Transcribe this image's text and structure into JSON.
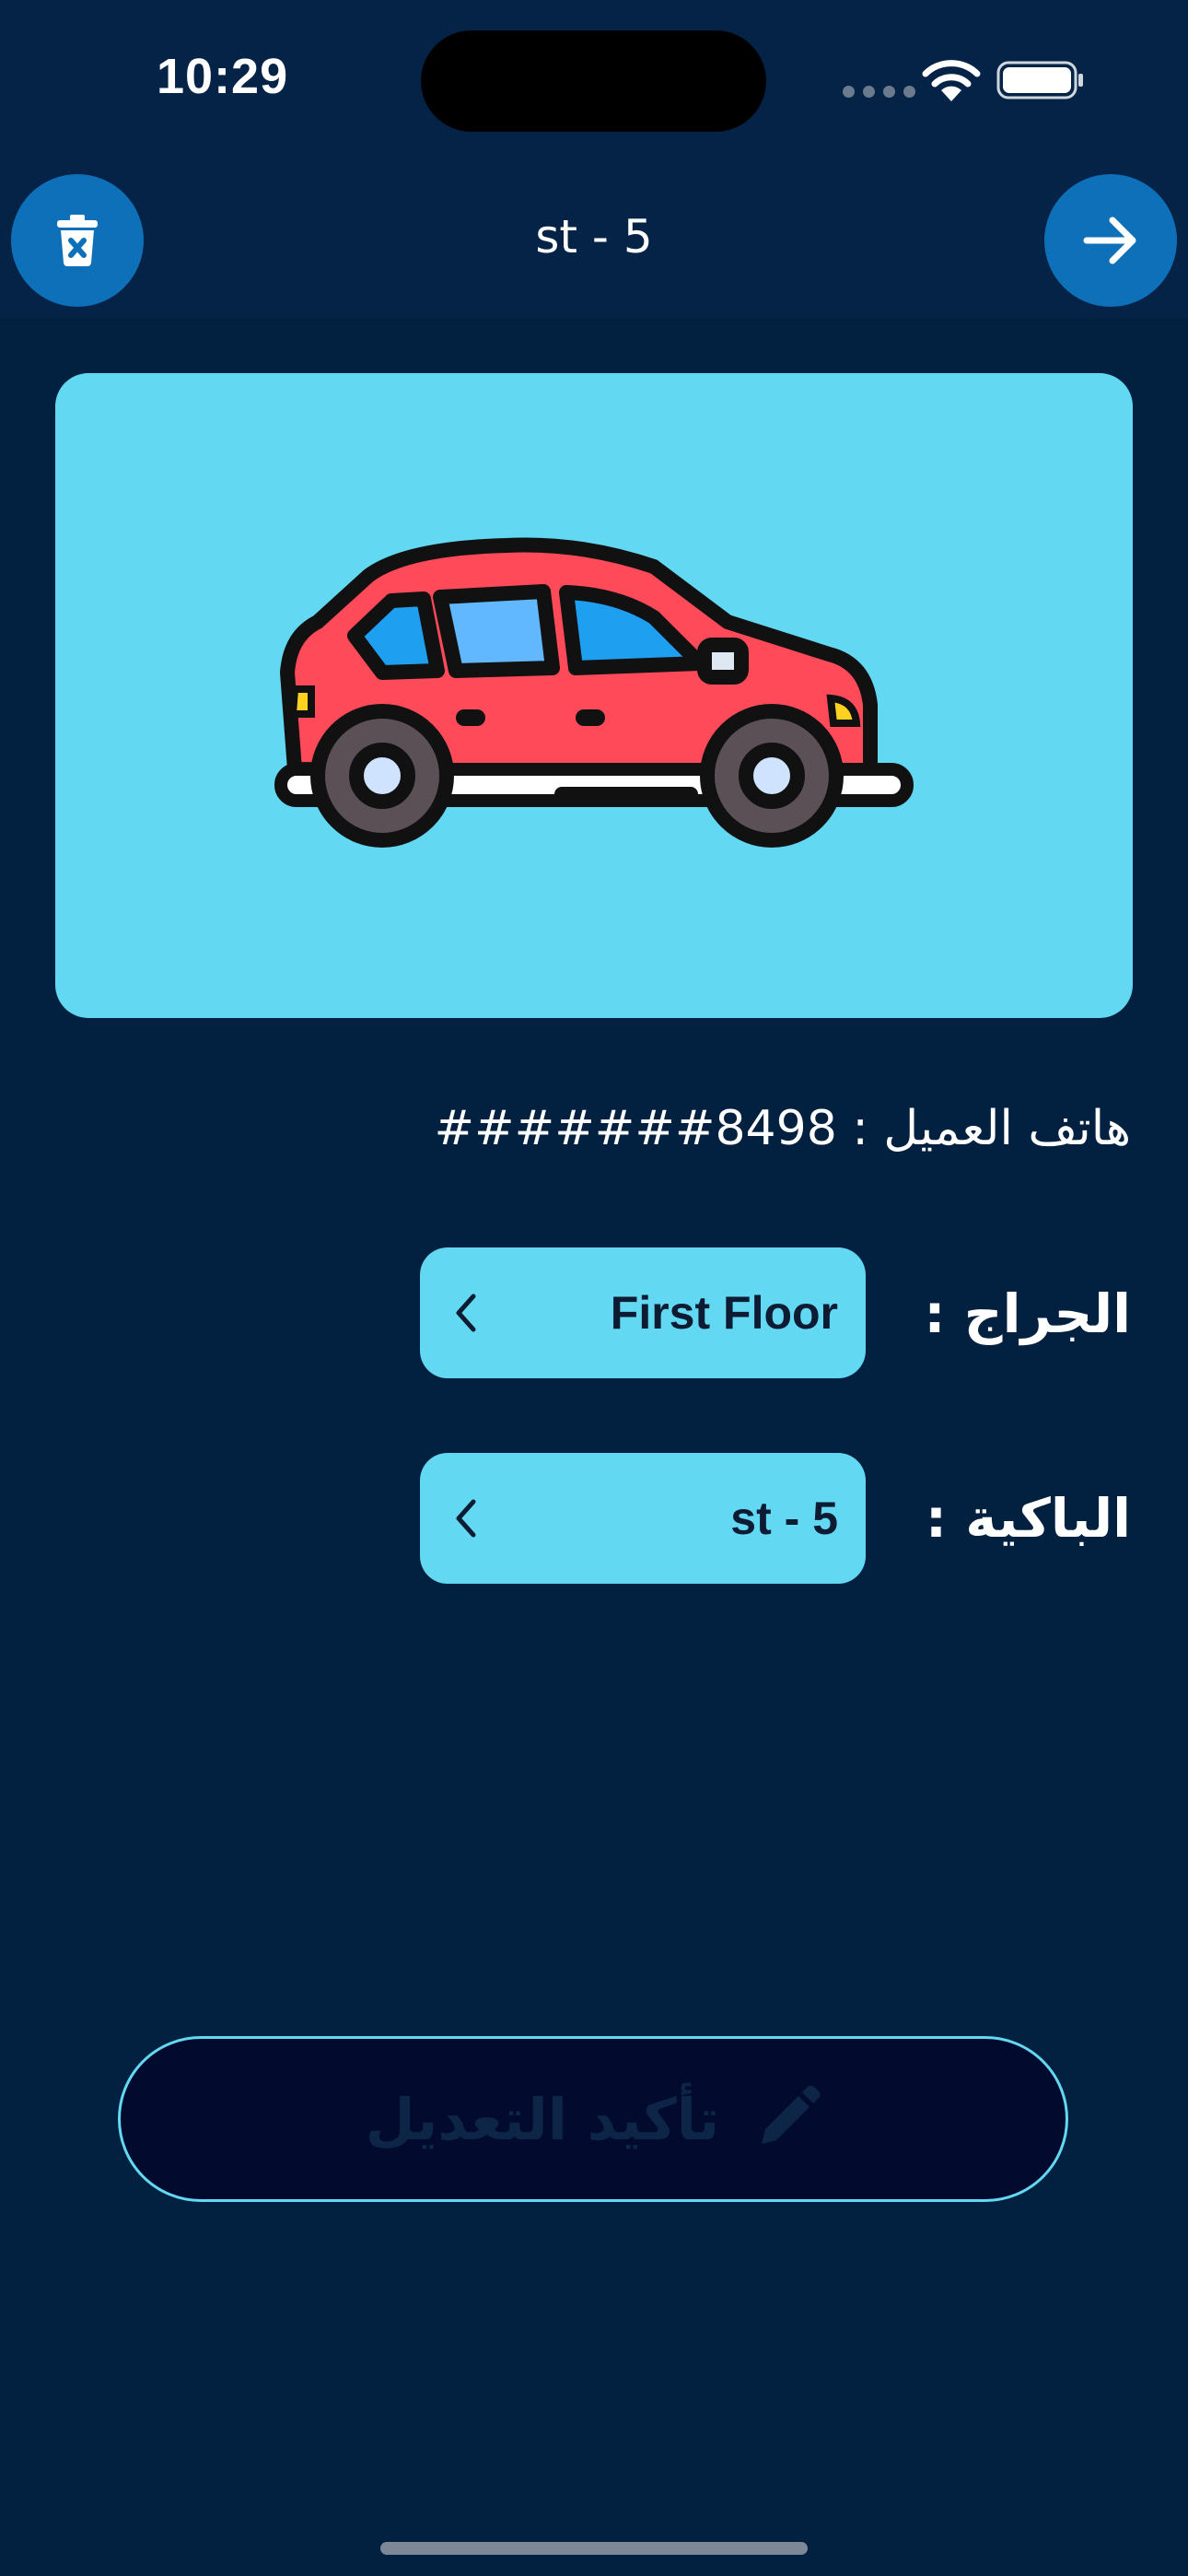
{
  "status_bar": {
    "time": "10:29"
  },
  "header": {
    "title": "st - 5",
    "delete_icon": "trash-x-icon",
    "forward_icon": "arrow-right-icon"
  },
  "car_card": {
    "icon": "car-icon"
  },
  "customer": {
    "label": "هاتف العميل :",
    "phone": "#######8498"
  },
  "garage": {
    "label": "الجراج :",
    "value": "First Floor"
  },
  "slot": {
    "label": "الباكية :",
    "value": "st - 5"
  },
  "confirm_button": {
    "label": "تأكيد التعديل",
    "icon": "pencil-icon"
  },
  "colors": {
    "background": "#02203f",
    "header": "#052346",
    "accent": "#62d8f2",
    "round_button": "#0d70b9",
    "confirm_bg": "#020a2e",
    "confirm_text": "#0d2547"
  }
}
